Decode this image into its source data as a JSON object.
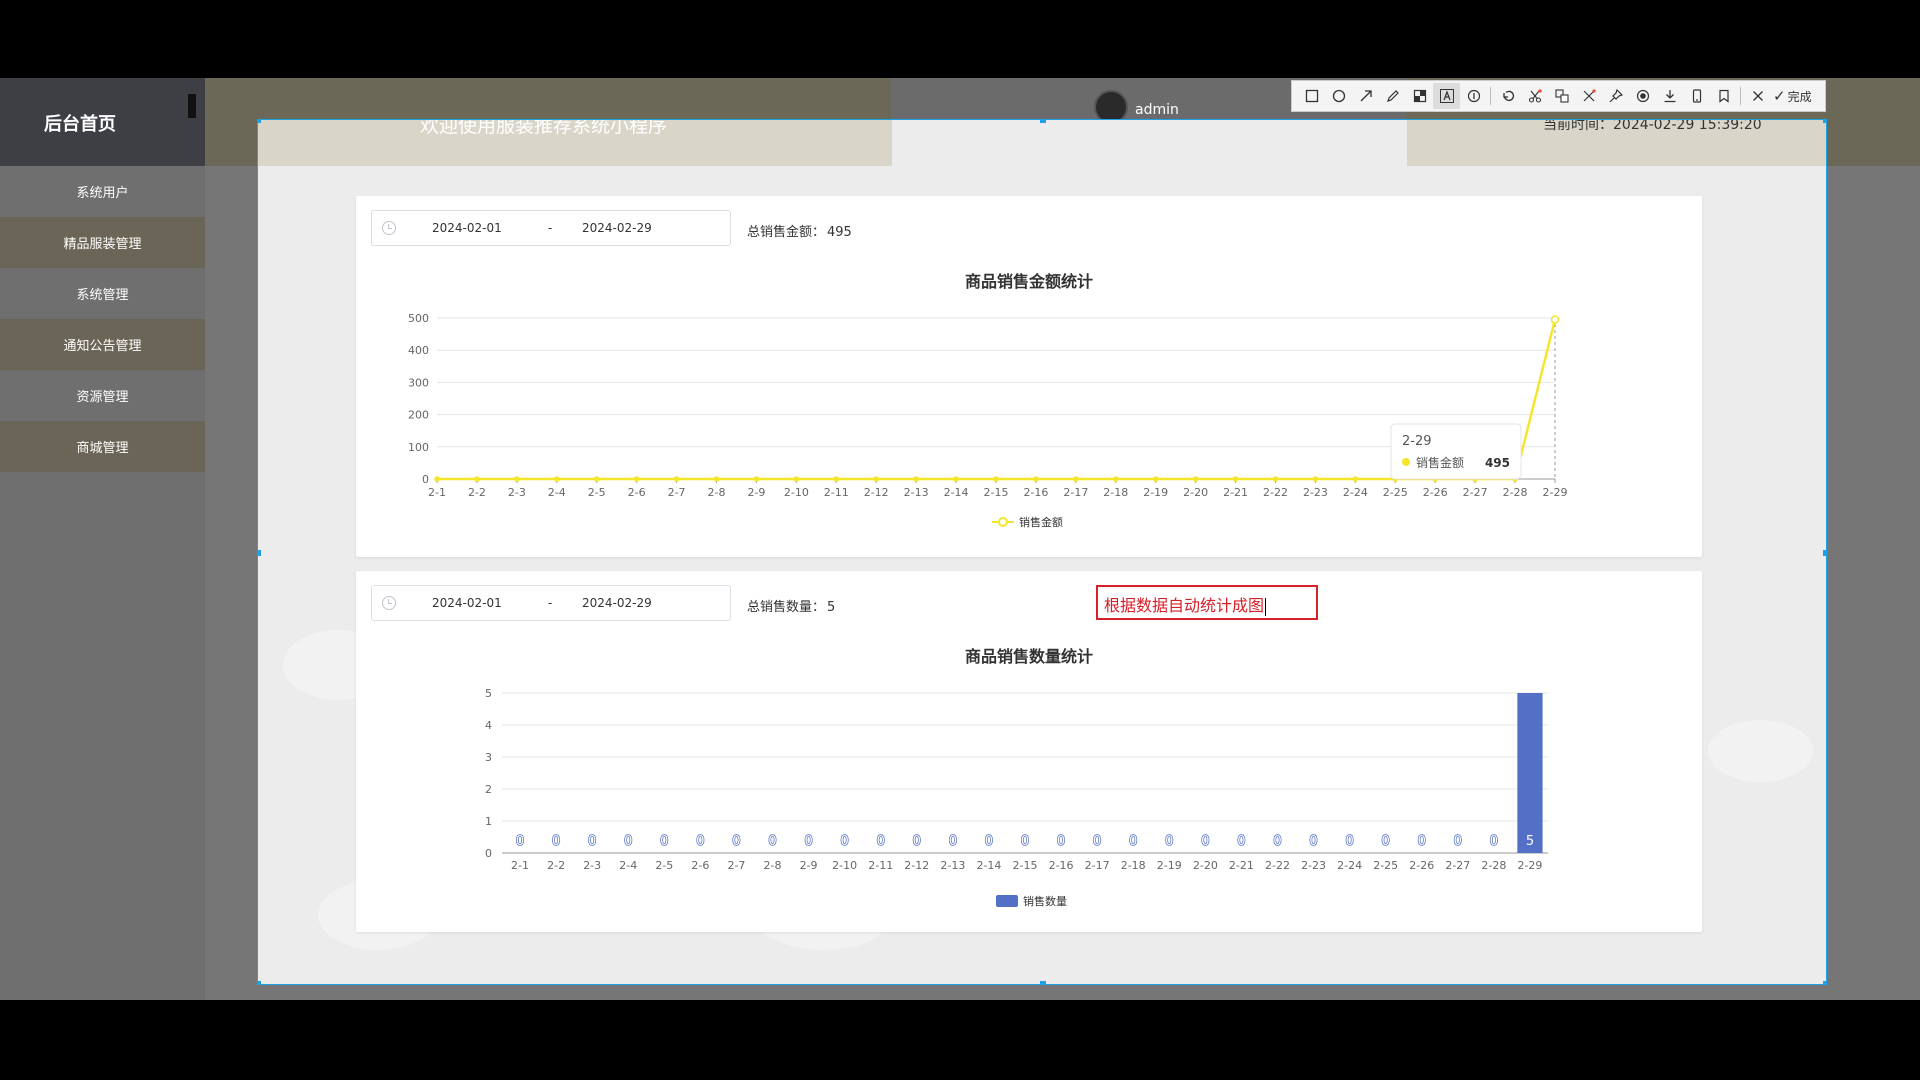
{
  "sidebar": {
    "title": "后台首页",
    "items": [
      {
        "label": "系统用户"
      },
      {
        "label": "精品服装管理"
      },
      {
        "label": "系统管理"
      },
      {
        "label": "通知公告管理"
      },
      {
        "label": "资源管理"
      },
      {
        "label": "商城管理"
      }
    ]
  },
  "header": {
    "welcome": "欢迎使用服装推荐系统小程序",
    "username": "admin",
    "clock": "当前时间：2024-02-29 15:39:20"
  },
  "panel1": {
    "start_date": "2024-02-01",
    "separator": "-",
    "end_date": "2024-02-29",
    "total_label": "总销售金额：",
    "total_value": "495"
  },
  "panel2": {
    "start_date": "2024-02-01",
    "separator": "-",
    "end_date": "2024-02-29",
    "total_label": "总销售数量：",
    "total_value": "5"
  },
  "annotation": {
    "text": "根据数据自动统计成图"
  },
  "toolbar": {
    "done_label": "完成"
  },
  "colors": {
    "line": "#f5e52b",
    "bar": "#5470c6",
    "annotation": "#d6202a",
    "selection": "#1aa3e8"
  },
  "chart_data": [
    {
      "type": "line",
      "title": "商品销售金额统计",
      "x": [
        "2-1",
        "2-2",
        "2-3",
        "2-4",
        "2-5",
        "2-6",
        "2-7",
        "2-8",
        "2-9",
        "2-10",
        "2-11",
        "2-12",
        "2-13",
        "2-14",
        "2-15",
        "2-16",
        "2-17",
        "2-18",
        "2-19",
        "2-20",
        "2-21",
        "2-22",
        "2-23",
        "2-24",
        "2-25",
        "2-26",
        "2-27",
        "2-28",
        "2-29"
      ],
      "series": [
        {
          "name": "销售金额",
          "values": [
            0,
            0,
            0,
            0,
            0,
            0,
            0,
            0,
            0,
            0,
            0,
            0,
            0,
            0,
            0,
            0,
            0,
            0,
            0,
            0,
            0,
            0,
            0,
            0,
            0,
            0,
            0,
            0,
            495
          ]
        }
      ],
      "ylim": [
        0,
        500
      ],
      "yticks": [
        0,
        100,
        200,
        300,
        400,
        500
      ],
      "legend": "bottom-center",
      "grid": true,
      "tooltip": {
        "x": "2-29",
        "series": "销售金额",
        "value": "495"
      }
    },
    {
      "type": "bar",
      "title": "商品销售数量统计",
      "categories": [
        "2-1",
        "2-2",
        "2-3",
        "2-4",
        "2-5",
        "2-6",
        "2-7",
        "2-8",
        "2-9",
        "2-10",
        "2-11",
        "2-12",
        "2-13",
        "2-14",
        "2-15",
        "2-16",
        "2-17",
        "2-18",
        "2-19",
        "2-20",
        "2-21",
        "2-22",
        "2-23",
        "2-24",
        "2-25",
        "2-26",
        "2-27",
        "2-28",
        "2-29"
      ],
      "series": [
        {
          "name": "销售数量",
          "values": [
            0,
            0,
            0,
            0,
            0,
            0,
            0,
            0,
            0,
            0,
            0,
            0,
            0,
            0,
            0,
            0,
            0,
            0,
            0,
            0,
            0,
            0,
            0,
            0,
            0,
            0,
            0,
            0,
            5
          ]
        }
      ],
      "ylim": [
        0,
        5
      ],
      "yticks": [
        0,
        1,
        2,
        3,
        4,
        5
      ],
      "legend": "bottom-center",
      "grid": true,
      "data_labels": true
    }
  ]
}
